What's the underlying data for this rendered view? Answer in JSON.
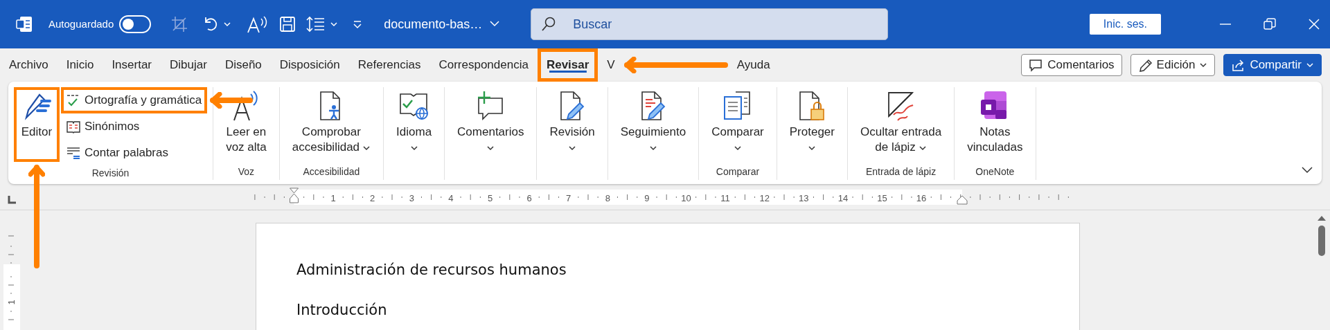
{
  "title_bar": {
    "autosave_label": "Autoguardado",
    "autosave_on": false,
    "document_name": "documento-bas…",
    "search_placeholder": "Buscar",
    "sign_in": "Inic. ses."
  },
  "tabs": [
    {
      "label": "Archivo",
      "selected": false,
      "highlighted": false
    },
    {
      "label": "Inicio",
      "selected": false,
      "highlighted": false
    },
    {
      "label": "Insertar",
      "selected": false,
      "highlighted": false
    },
    {
      "label": "Dibujar",
      "selected": false,
      "highlighted": false
    },
    {
      "label": "Diseño",
      "selected": false,
      "highlighted": false
    },
    {
      "label": "Disposición",
      "selected": false,
      "highlighted": false
    },
    {
      "label": "Referencias",
      "selected": false,
      "highlighted": false
    },
    {
      "label": "Correspondencia",
      "selected": false,
      "highlighted": false
    },
    {
      "label": "Revisar",
      "selected": true,
      "highlighted": true,
      "arrow": true
    },
    {
      "label": "V",
      "selected": false,
      "highlighted": false
    },
    {
      "label": "Ayuda",
      "selected": false,
      "highlighted": false
    }
  ],
  "tab_actions": [
    {
      "kind": "outline",
      "label": "Comentarios"
    },
    {
      "kind": "dropdown",
      "label": "Edición"
    },
    {
      "kind": "primary",
      "label": "Compartir"
    }
  ],
  "ribbon": {
    "groups": [
      {
        "label": "Revisión",
        "items": [
          {
            "kind": "large",
            "label": "Editor",
            "highlighted": true,
            "arrow": true
          },
          {
            "kind": "small",
            "label": "Ortografía y gramática",
            "highlighted": true,
            "arrow": true
          },
          {
            "kind": "small",
            "label": "Sinónimos",
            "highlighted": false
          },
          {
            "kind": "small",
            "label": "Contar palabras",
            "highlighted": false
          }
        ]
      },
      {
        "label": "Voz",
        "items": [
          {
            "kind": "large",
            "label": "Leer en\nvoz alta",
            "highlighted": false
          }
        ]
      },
      {
        "label": "Accesibilidad",
        "items": [
          {
            "kind": "combo",
            "label": "Comprobar\naccesibilidad",
            "highlighted": false
          }
        ]
      },
      {
        "items": [
          {
            "kind": "menu",
            "label": "Idioma",
            "highlighted": false
          }
        ]
      },
      {
        "items": [
          {
            "kind": "menu",
            "label": "Comentarios",
            "highlighted": false
          }
        ]
      },
      {
        "items": [
          {
            "kind": "menu",
            "label": "Revisión",
            "highlighted": false
          }
        ]
      },
      {
        "items": [
          {
            "kind": "menu",
            "label": "Seguimiento",
            "highlighted": false
          }
        ]
      },
      {
        "label": "Comparar",
        "items": [
          {
            "kind": "menu",
            "label": "Comparar",
            "highlighted": false
          }
        ]
      },
      {
        "items": [
          {
            "kind": "menu",
            "label": "Proteger",
            "highlighted": false
          }
        ]
      },
      {
        "label": "Entrada de lápiz",
        "items": [
          {
            "kind": "combo",
            "label": "Ocultar entrada\nde lápiz",
            "highlighted": false
          }
        ]
      },
      {
        "label": "OneNote",
        "items": [
          {
            "kind": "large",
            "label": "Notas\nvinculadas",
            "highlighted": false
          }
        ]
      }
    ]
  },
  "ruler": {
    "numbers": [
      "1",
      "2",
      "3",
      "4",
      "5",
      "6",
      "7",
      "8",
      "9",
      "10",
      "11",
      "12",
      "13",
      "14",
      "15",
      "16"
    ]
  },
  "vertical_ruler": {
    "numbers": [
      "1"
    ]
  },
  "document": {
    "paragraphs": [
      "Administración de recursos humanos",
      "Introducción"
    ]
  }
}
